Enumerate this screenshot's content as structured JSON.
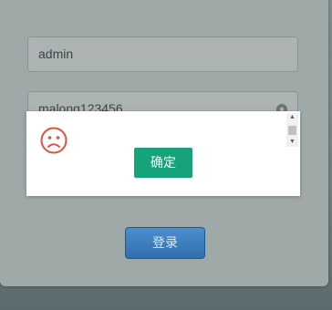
{
  "login": {
    "username_value": "admin",
    "password_value": "malong123456",
    "submit_label": "登录"
  },
  "dialog": {
    "icon": "sad-face-icon",
    "confirm_label": "确定"
  },
  "colors": {
    "confirm": "#16a37b",
    "submit": "#2f6fae",
    "sad_icon": "#e0533b"
  }
}
